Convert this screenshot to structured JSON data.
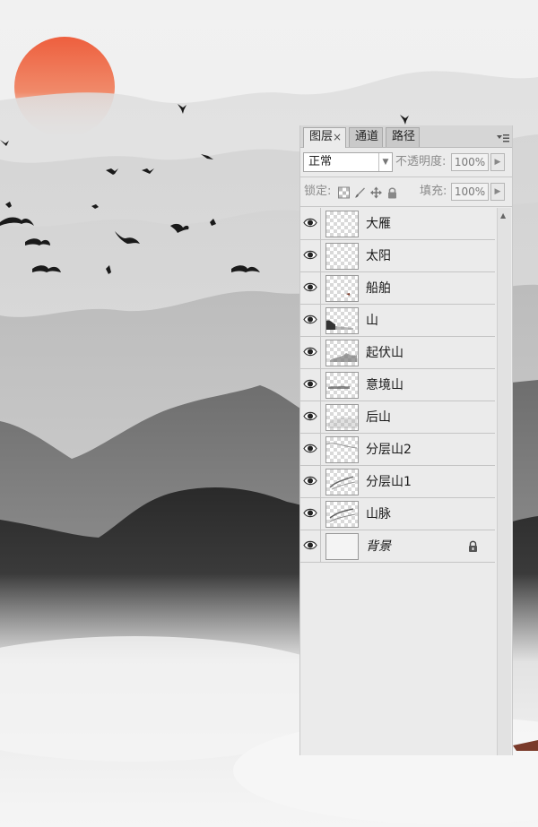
{
  "panel": {
    "tabs": [
      {
        "label": "图层",
        "close": "×"
      },
      {
        "label": "通道"
      },
      {
        "label": "路径"
      }
    ],
    "blend_mode": "正常",
    "opacity_label": "不透明度:",
    "opacity_value": "100%",
    "lock_label": "锁定:",
    "fill_label": "填充:",
    "fill_value": "100%",
    "layers": [
      {
        "name": "大雁"
      },
      {
        "name": "太阳"
      },
      {
        "name": "船舶"
      },
      {
        "name": "山"
      },
      {
        "name": "起伏山"
      },
      {
        "name": "意境山"
      },
      {
        "name": "后山"
      },
      {
        "name": "分层山2"
      },
      {
        "name": "分层山1"
      },
      {
        "name": "山脉"
      },
      {
        "name": "背景"
      }
    ]
  },
  "colors": {
    "sun": "#ee6a48",
    "mist_light": "#efefef",
    "mountain_dark": "#2f2f2f",
    "panel_bg": "#ebebeb"
  }
}
